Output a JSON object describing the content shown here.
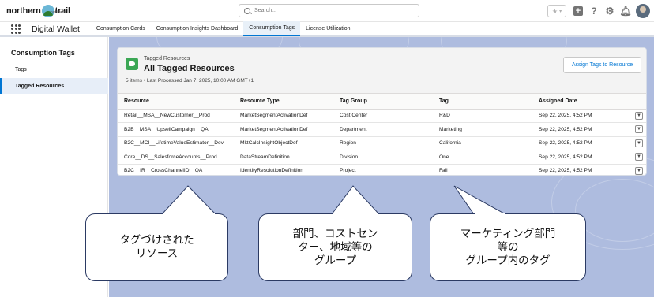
{
  "header": {
    "logo_left": "northern",
    "logo_right": "trail",
    "logo_sub": "outfitters",
    "search_placeholder": "Search..."
  },
  "app": {
    "name": "Digital Wallet",
    "tabs": [
      {
        "label": "Consumption Cards",
        "active": false
      },
      {
        "label": "Consumption Insights Dashboard",
        "active": false
      },
      {
        "label": "Consumption Tags",
        "active": true
      },
      {
        "label": "License Utilization",
        "active": false
      }
    ]
  },
  "sidebar": {
    "title": "Consumption Tags",
    "items": [
      {
        "label": "Tags",
        "active": false
      },
      {
        "label": "Tagged Resources",
        "active": true
      }
    ]
  },
  "card": {
    "eyebrow": "Tagged Resources",
    "title": "All Tagged Resources",
    "meta": "5 items • Last Processed Jan 7, 2025, 10:00 AM GMT+1",
    "assign_button": "Assign Tags to Resource"
  },
  "table": {
    "columns": [
      "Resource ↓",
      "Resource Type",
      "Tag Group",
      "Tag",
      "Assigned Date"
    ],
    "rows": [
      [
        "Retail__MSA__NewCustomer__Prod",
        "MarketSegmentActivationDef",
        "Cost Center",
        "R&D",
        "Sep 22, 2025, 4:52 PM"
      ],
      [
        "B2B__MSA__UpsellCampaign__QA",
        "MarketSegmentActivationDef",
        "Department",
        "Marketing",
        "Sep 22, 2025, 4:52 PM"
      ],
      [
        "B2C__MCI__LifetimeValueEstimator__Dev",
        "MktCalcInsightObjectDef",
        "Region",
        "California",
        "Sep 22, 2025, 4:52 PM"
      ],
      [
        "Core__DS__SalesforceAccounts__Prod",
        "DataStreamDefinition",
        "Division",
        "One",
        "Sep 22, 2025, 4:52 PM"
      ],
      [
        "B2C__IR__CrossChannelID__QA",
        "IdentityResolutionDefinition",
        "Project",
        "Fall",
        "Sep 22, 2025, 4:52 PM"
      ]
    ]
  },
  "callouts": [
    {
      "text": "タグづけされた\nリソース"
    },
    {
      "text": "部門、コストセン\nター、地域等の\nグループ"
    },
    {
      "text": "マーケティング部門\n等の\nグループ内のタグ"
    }
  ],
  "colors": {
    "accent": "#0176d3",
    "background": "#aebcdf",
    "object_icon": "#3ba755"
  }
}
